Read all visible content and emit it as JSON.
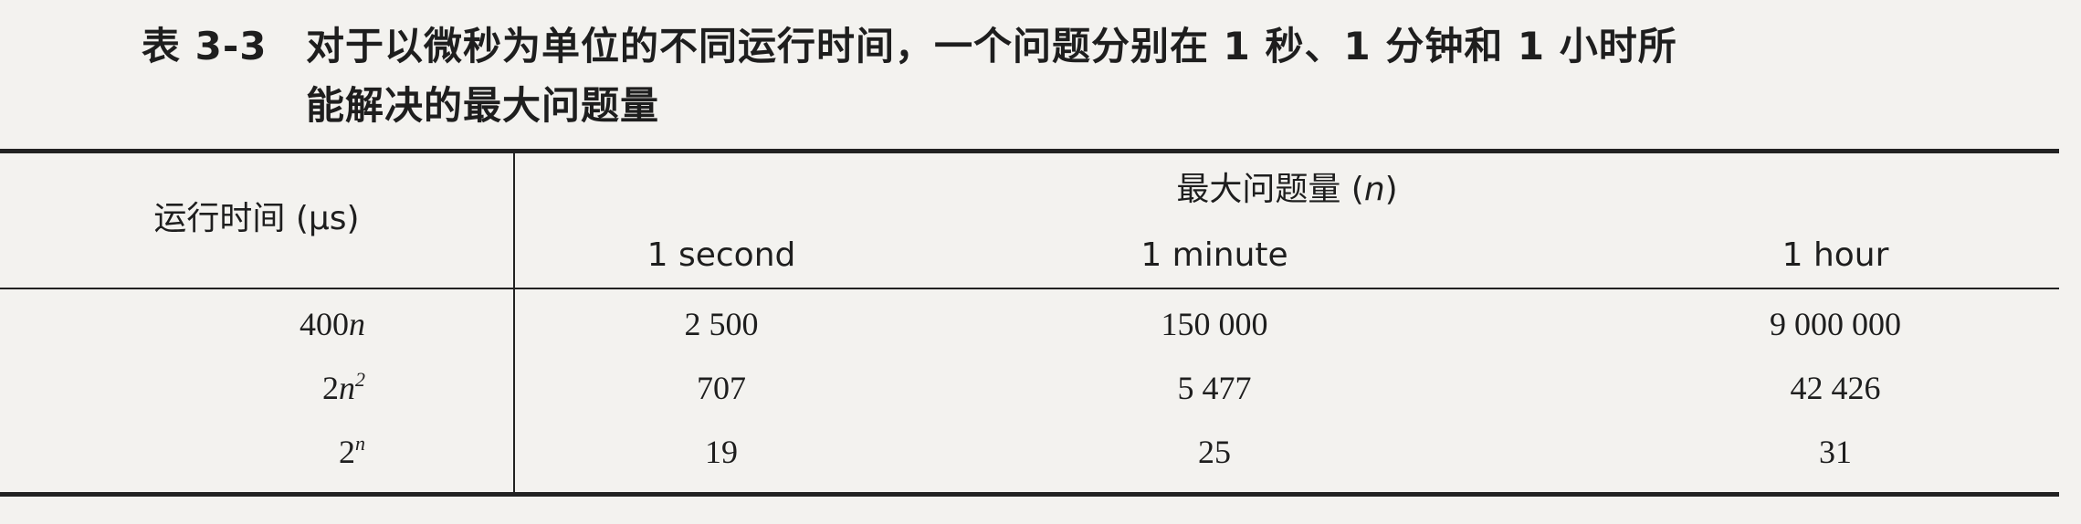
{
  "caption": {
    "number": "表 3-3",
    "line1": "对于以微秒为单位的不同运行时间，一个问题分别在 1 秒、1 分钟和 1 小时所",
    "line2": "能解决的最大问题量"
  },
  "table": {
    "row_header": "运行时间 (μs)",
    "group_header": "最大问题量 (n)",
    "columns": [
      "1 second",
      "1 minute",
      "1 hour"
    ],
    "rows": [
      {
        "base": "400",
        "var": "n",
        "exp": "",
        "values": [
          "2 500",
          "150 000",
          "9 000 000"
        ]
      },
      {
        "base": "2",
        "var": "n",
        "exp": "2",
        "values": [
          "707",
          "5 477",
          "42 426"
        ]
      },
      {
        "base": "2",
        "var": "",
        "exp": "n",
        "values": [
          "19",
          "25",
          "31"
        ]
      }
    ]
  }
}
